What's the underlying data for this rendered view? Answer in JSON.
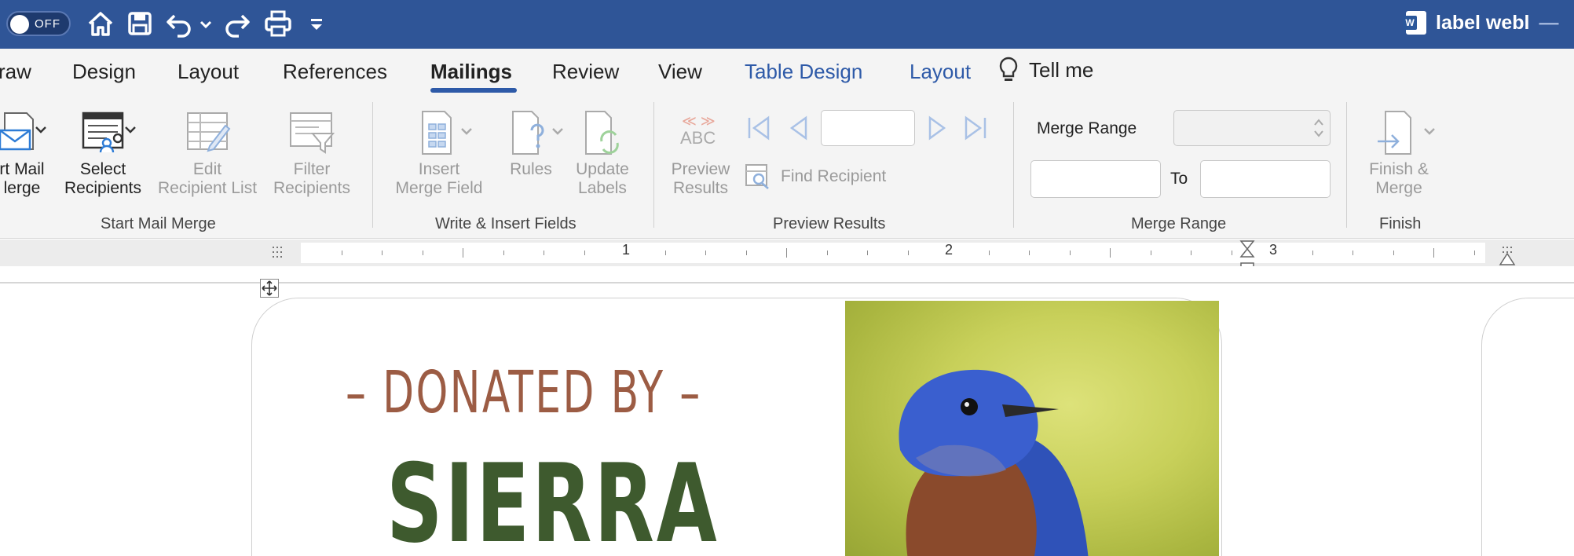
{
  "titlebar": {
    "autosave_state": "OFF",
    "doc_title": "label webl",
    "doc_title_suffix": "—",
    "icons": [
      "home-icon",
      "save-icon",
      "undo-icon",
      "redo-icon",
      "print-icon",
      "customize-toolbar-icon"
    ]
  },
  "tabs": [
    {
      "label": "raw"
    },
    {
      "label": "Design"
    },
    {
      "label": "Layout"
    },
    {
      "label": "References"
    },
    {
      "label": "Mailings"
    },
    {
      "label": "Review"
    },
    {
      "label": "View"
    },
    {
      "label": "Table Design"
    },
    {
      "label": "Layout"
    }
  ],
  "tell_me": "Tell me",
  "ribbon": {
    "start_mail_merge": {
      "line1": "rt Mail",
      "line2": "lerge",
      "select_recipients_1": "Select",
      "select_recipients_2": "Recipients",
      "edit_list_1": "Edit",
      "edit_list_2": "Recipient List",
      "filter_1": "Filter",
      "filter_2": "Recipients",
      "group_label": "Start Mail Merge"
    },
    "write_insert": {
      "insert_1": "Insert",
      "insert_2": "Merge Field",
      "rules": "Rules",
      "update_1": "Update",
      "update_2": "Labels",
      "group_label": "Write & Insert Fields"
    },
    "preview": {
      "preview_1": "Preview",
      "preview_2": "Results",
      "abc_glyph": "ABC",
      "find_recipient": "Find Recipient",
      "record_value": "",
      "group_label": "Preview Results"
    },
    "merge_range": {
      "label": "Merge Range",
      "range_select_value": "",
      "from_value": "",
      "to_label": "To",
      "to_value": "",
      "group_label": "Merge Range"
    },
    "finish": {
      "finish_1": "Finish &",
      "finish_2": "Merge",
      "group_label": "Finish"
    }
  },
  "ruler": {
    "numbers": [
      "1",
      "2",
      "3"
    ]
  },
  "document": {
    "donated_by": "– DONATED BY –",
    "name": "SIERRA",
    "colors": {
      "donated": "#9c5c44",
      "name": "#3e5a2e",
      "titlebar": "#2f5597",
      "accent": "#2e5aa8"
    }
  }
}
